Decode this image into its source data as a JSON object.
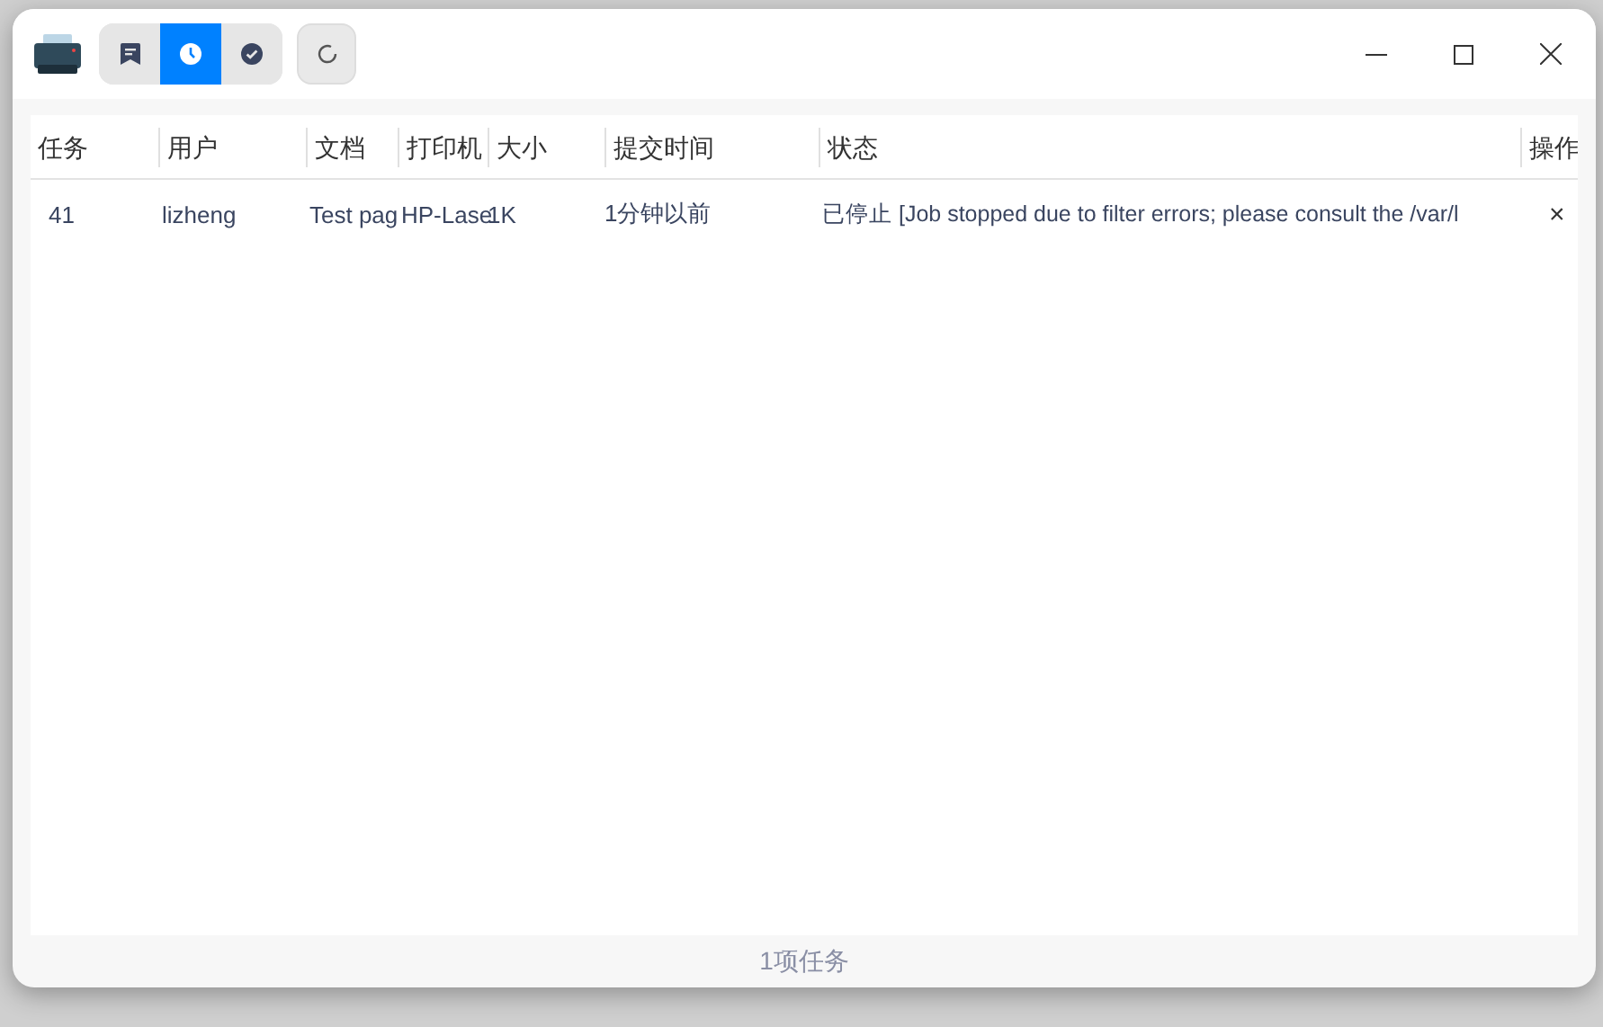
{
  "toolbar": {
    "view_buttons": [
      {
        "kind": "bookmark",
        "selected": false
      },
      {
        "kind": "clock",
        "selected": true
      },
      {
        "kind": "check",
        "selected": false
      }
    ]
  },
  "table": {
    "columns": [
      "任务",
      "用户",
      "文档",
      "打印机",
      "大小",
      "提交时间",
      "状态",
      "操作"
    ],
    "rows": [
      {
        "cells": [
          "41",
          "lizheng",
          "Test pag",
          "HP-Lase",
          "1K",
          "1分钟以前",
          "已停止 [Job stopped due to filter errors; please consult the /var/l"
        ],
        "action": "×"
      }
    ]
  },
  "status_bar": "1项任务"
}
